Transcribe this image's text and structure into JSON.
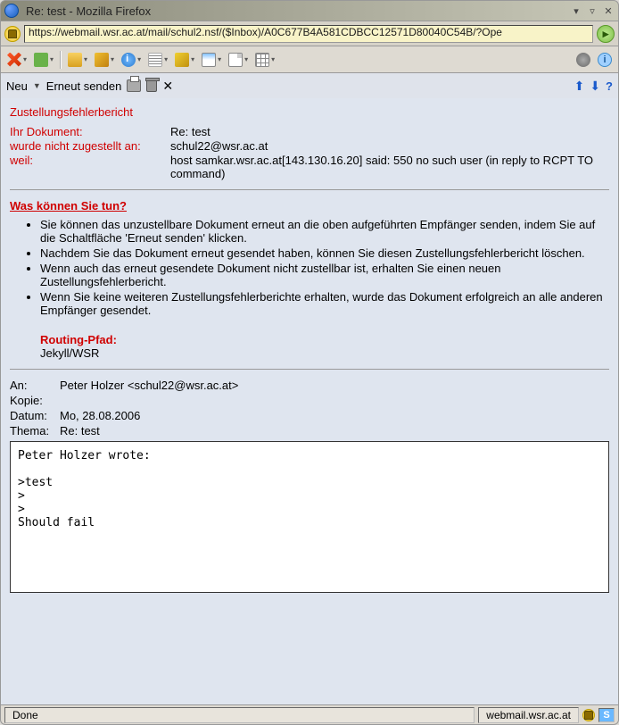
{
  "titlebar": {
    "title": "Re: test - Mozilla Firefox"
  },
  "url": "https://webmail.wsr.ac.at/mail/schul2.nsf/($Inbox)/A0C677B4A581CDBCC12571D80040C54B/?Ope",
  "toolbar2": {
    "new_label": "Neu",
    "resend_label": "Erneut senden"
  },
  "ndr": {
    "heading": "Zustellungsfehlerbericht",
    "labels": {
      "your_doc": "Ihr Dokument:",
      "not_delivered_to": "wurde nicht zugestellt an:",
      "because": "weil:"
    },
    "values": {
      "subject": "Re: test",
      "recipient": "schul22@wsr.ac.at",
      "reason": "host samkar.wsr.ac.at[143.130.16.20] said: 550 no such user (in reply to RCPT TO command)"
    },
    "what_heading": "Was können Sie tun?",
    "bullets": [
      "Sie können das unzustellbare Dokument erneut an die oben aufgeführten Empfänger senden, indem Sie auf die Schaltfläche 'Erneut senden' klicken.",
      "Nachdem Sie das Dokument erneut gesendet haben, können Sie diesen Zustellungsfehlerbericht löschen.",
      "Wenn auch das erneut gesendete Dokument nicht zustellbar ist, erhalten Sie einen neuen Zustellungsfehlerbericht.",
      "Wenn Sie keine weiteren Zustellungsfehlerberichte erhalten, wurde das Dokument erfolgreich an alle anderen Empfänger gesendet."
    ],
    "routing_heading": "Routing-Pfad:",
    "routing_value": "Jekyll/WSR"
  },
  "meta": {
    "labels": {
      "to": "An:",
      "cc": "Kopie:",
      "date": "Datum:",
      "subject": "Thema:"
    },
    "to": "Peter Holzer <schul22@wsr.ac.at>",
    "cc": "",
    "date": "Mo, 28.08.2006",
    "subject": "Re: test"
  },
  "body_text": "Peter Holzer wrote:\n\n>test\n>\n>\nShould fail",
  "statusbar": {
    "done": "Done",
    "host": "webmail.wsr.ac.at",
    "s": "S"
  }
}
